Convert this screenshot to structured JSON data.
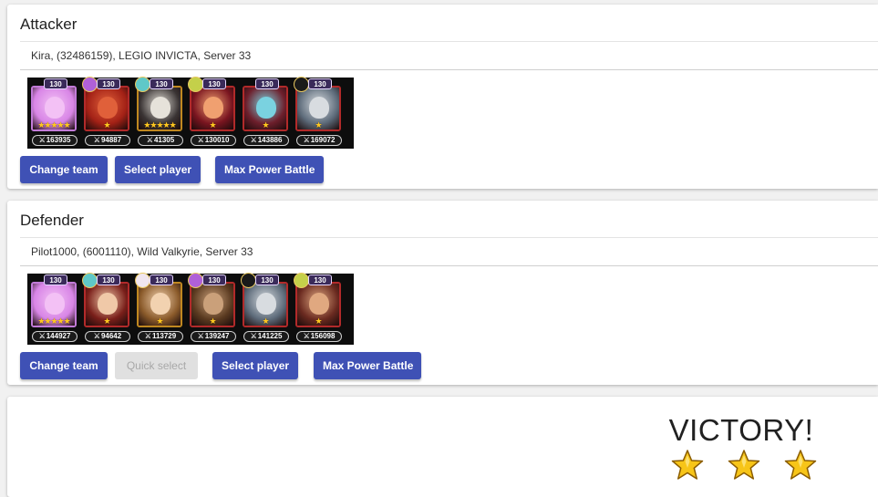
{
  "attacker": {
    "title": "Attacker",
    "player": "Kira, (32486159), LEGIO INVICTA, Server 33",
    "heroes": [
      {
        "level": "130",
        "stars": "★★★★★",
        "power": "163935",
        "frame": "purple",
        "skin": "#d885e6",
        "face": "#f3c1f5",
        "pet": null
      },
      {
        "level": "130",
        "stars": "★",
        "power": "94887",
        "frame": "red",
        "skin": "#a32116",
        "face": "#e0603a",
        "pet": "#b060d8"
      },
      {
        "level": "130",
        "stars": "★★★★★",
        "power": "41305",
        "frame": "gold",
        "skin": "#3a3434",
        "face": "#e6e2da",
        "pet": "#5fc8c8"
      },
      {
        "level": "130",
        "stars": "★",
        "power": "130010",
        "frame": "red",
        "skin": "#7a1520",
        "face": "#f0a070",
        "pet": "#c4d04a"
      },
      {
        "level": "130",
        "stars": "★",
        "power": "143886",
        "frame": "red",
        "skin": "#6e1f2c",
        "face": "#7ad2e0",
        "pet": null
      },
      {
        "level": "130",
        "stars": "★",
        "power": "169072",
        "frame": "red",
        "skin": "#5d6b7a",
        "face": "#d8dce0",
        "pet": "#1a1a1a"
      }
    ],
    "buttons": {
      "change_team": "Change team",
      "select_player": "Select player",
      "max_power": "Max Power Battle"
    }
  },
  "defender": {
    "title": "Defender",
    "player": "Pilot1000, (6001110), Wild Valkyrie, Server 33",
    "heroes": [
      {
        "level": "130",
        "stars": "★★★★★",
        "power": "144927",
        "frame": "purple",
        "skin": "#d885e6",
        "face": "#f3c1f5",
        "pet": null
      },
      {
        "level": "130",
        "stars": "★",
        "power": "94642",
        "frame": "red",
        "skin": "#7a1f1a",
        "face": "#f0c9a8",
        "pet": "#5fc8c8"
      },
      {
        "level": "130",
        "stars": "★",
        "power": "113729",
        "frame": "gold",
        "skin": "#8a5a2a",
        "face": "#f2d2b0",
        "pet": "#f0e6ef"
      },
      {
        "level": "130",
        "stars": "★",
        "power": "139247",
        "frame": "red",
        "skin": "#5a3a20",
        "face": "#caa07a",
        "pet": "#b060d8"
      },
      {
        "level": "130",
        "stars": "★",
        "power": "141225",
        "frame": "red",
        "skin": "#5d6b7a",
        "face": "#d8dce0",
        "pet": "#1a1a1a"
      },
      {
        "level": "130",
        "stars": "★",
        "power": "156098",
        "frame": "red",
        "skin": "#6a2a20",
        "face": "#e0a880",
        "pet": "#c4d04a"
      }
    ],
    "buttons": {
      "change_team": "Change team",
      "quick_select": "Quick select",
      "select_player": "Select player",
      "max_power": "Max Power Battle"
    }
  },
  "result": {
    "text": "VICTORY!",
    "stars": 3,
    "star_color": "#f7c518"
  },
  "colors": {
    "primary": "#3f51b5",
    "disabled": "#e0e0e0",
    "background": "#f1f1f1"
  }
}
